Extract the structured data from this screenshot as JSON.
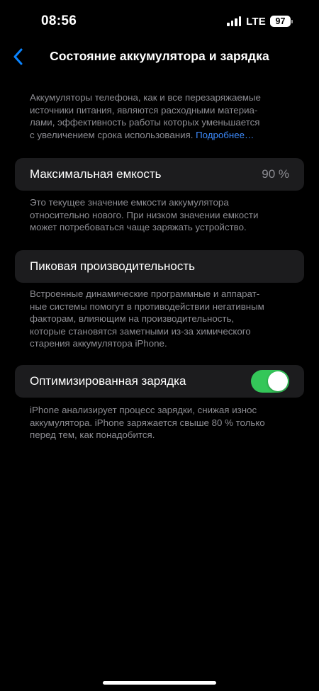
{
  "status_bar": {
    "time": "08:56",
    "network": "LTE",
    "battery_level": "97",
    "signal_bars": 4
  },
  "nav": {
    "title": "Состояние аккумулятора и зарядка",
    "back_icon": "chevron-left-icon"
  },
  "intro": {
    "lines": [
      "Аккумуляторы телефона, как и все перезаряжаемые",
      "источники питания, являются расходными материа-",
      "лами, эффективность работы которых уменьшается",
      "с увеличением срока использования."
    ],
    "link": "Подробнее…"
  },
  "max_capacity": {
    "label": "Максимальная емкость",
    "value": "90 %",
    "desc_lines": [
      "Это текущее значение емкости аккумулятора",
      "относительно нового. При низком значении емкости",
      "может потребоваться чаще заряжать устройство."
    ]
  },
  "peak_performance": {
    "label": "Пиковая производительность",
    "desc_lines": [
      "Встроенные динамические программные и аппарат-",
      "ные системы помогут в противодействии негативным",
      "факторам, влияющим на производительность,",
      "которые становятся заметными из-за химического",
      "старения аккумулятора iPhone."
    ]
  },
  "optimized_charging": {
    "label": "Оптимизированная зарядка",
    "enabled": true,
    "desc_lines": [
      "iPhone анализирует процесс зарядки, снижая износ",
      "аккумулятора. iPhone заряжается свыше 80 % только",
      "перед тем, как понадобится."
    ]
  },
  "colors": {
    "background": "#000000",
    "cell": "#1c1c1e",
    "secondary_text": "#8d8d93",
    "link": "#3d8bfd",
    "toggle_on": "#34c759",
    "accent": "#0a84ff"
  }
}
